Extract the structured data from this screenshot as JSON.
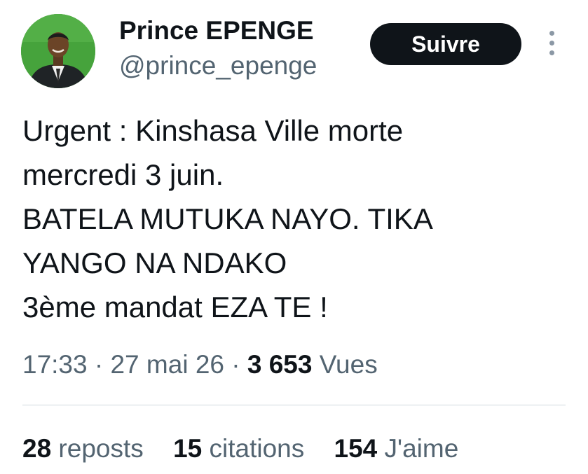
{
  "author": {
    "display_name": "Prince EPENGE",
    "handle": "@prince_epenge",
    "avatar_icon": "profile-photo"
  },
  "follow_button": {
    "label": "Suivre"
  },
  "more_menu": {
    "icon": "more-vertical-icon"
  },
  "tweet": {
    "lines": [
      "Urgent : Kinshasa Ville morte",
      "mercredi 3 juin.",
      "BATELA MUTUKA NAYO. TIKA",
      "YANGO NA NDAKO",
      "3ème mandat EZA TE !"
    ]
  },
  "meta": {
    "time": "17:33",
    "separator": " · ",
    "date": "27 mai 26",
    "views_count": "3 653",
    "views_label": " Vues"
  },
  "stats": {
    "reposts": {
      "count": "28",
      "label": " reposts"
    },
    "quotes": {
      "count": "15",
      "label": " citations"
    },
    "likes": {
      "count": "154",
      "label": " J'aime"
    }
  },
  "colors": {
    "text_primary": "#0f1419",
    "text_secondary": "#536471",
    "button_bg": "#0f1419",
    "avatar_bg": "#46a33c",
    "divider": "#cfd9de"
  }
}
